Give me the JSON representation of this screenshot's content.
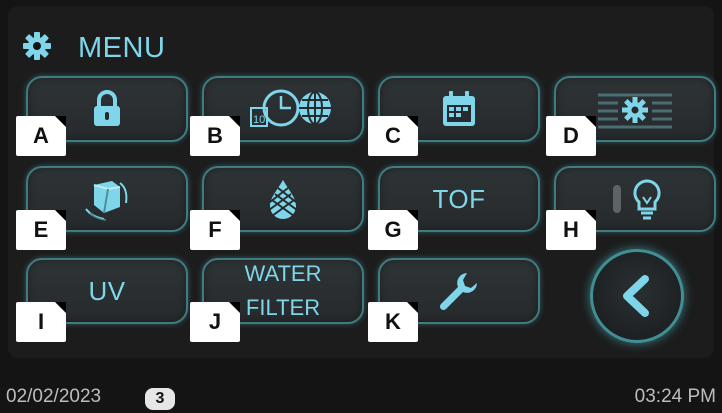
{
  "header": {
    "title": "MENU",
    "icon": "gear-icon"
  },
  "colors": {
    "accent": "#7fd6ea",
    "tile_border": "#3f7b80",
    "background": "#141414"
  },
  "tiles": [
    {
      "tag": "A",
      "icon": "lock-icon"
    },
    {
      "tag": "B",
      "icon": "clock-globe-icon"
    },
    {
      "tag": "C",
      "icon": "calendar-icon"
    },
    {
      "tag": "D",
      "icon": "settings-list-icon"
    },
    {
      "tag": "E",
      "icon": "ice-cube-icon"
    },
    {
      "tag": "F",
      "icon": "water-drop-icon"
    },
    {
      "tag": "G",
      "label": "TOF"
    },
    {
      "tag": "H",
      "icon": "light-bulb-icon"
    },
    {
      "tag": "I",
      "label": "UV"
    },
    {
      "tag": "J",
      "label_line1": "WATER",
      "label_line2": "FILTER"
    },
    {
      "tag": "K",
      "icon": "wrench-icon"
    }
  ],
  "back_button": {
    "icon": "chevron-left-icon"
  },
  "footer": {
    "date": "02/02/2023",
    "badge": "3",
    "time": "03:24 PM"
  }
}
